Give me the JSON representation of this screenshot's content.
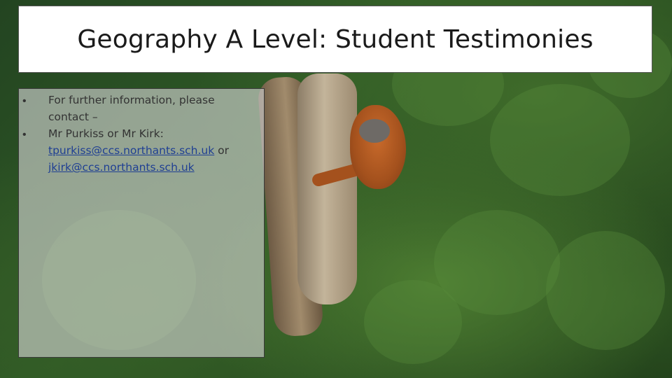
{
  "slide": {
    "title": "Geography A Level: Student Testimonies",
    "bullets": [
      {
        "lines": [
          "For further information, please",
          "contact –"
        ]
      },
      {
        "lines": [
          "Mr Purkiss or Mr Kirk:"
        ],
        "email_1": "tpurkiss@ccs.northants.sch.uk",
        "separator": " or",
        "email_2": "jkirk@ccs.northants.sch.uk"
      }
    ],
    "bullet_symbol": "•"
  },
  "background": {
    "icon": "rainforest-orangutan-photo"
  }
}
